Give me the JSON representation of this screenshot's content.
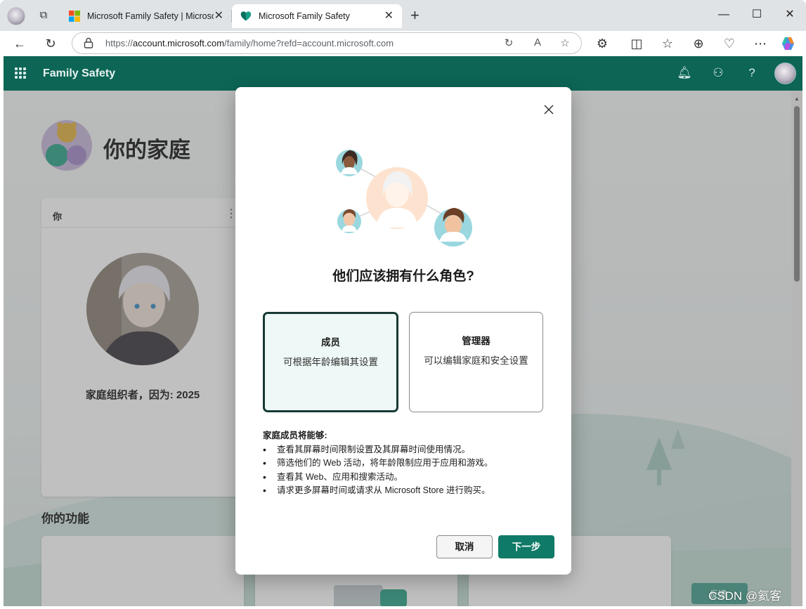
{
  "browser": {
    "tabs": [
      {
        "title": "Microsoft Family Safety | Microsoft",
        "active": false
      },
      {
        "title": "Microsoft Family Safety",
        "active": true
      }
    ],
    "url_prefix": "https://",
    "url_host": "account.microsoft.com",
    "url_path": "/family/home?refd=account.microsoft.com"
  },
  "app": {
    "title": "Family Safety"
  },
  "background": {
    "family_title": "你的家庭",
    "card_title": "你",
    "organizer_text": "家庭组织者，因为: 2025",
    "features_title": "你的功能",
    "feedback_label": "反馈"
  },
  "dialog": {
    "question": "他们应该拥有什么角色?",
    "roles": [
      {
        "name": "成员",
        "description": "可根据年龄编辑其设置",
        "selected": true
      },
      {
        "name": "管理器",
        "description": "可以编辑家庭和安全设置",
        "selected": false
      }
    ],
    "abilities_title": "家庭成员将能够:",
    "abilities": [
      "查看其屏幕时间限制设置及其屏幕时间使用情况。",
      "筛选他们的 Web 活动，将年龄限制应用于应用和游戏。",
      "查看其 Web、应用和搜索活动。",
      "请求更多屏幕时间或请求从 Microsoft Store 进行购买。"
    ],
    "cancel_label": "取消",
    "next_label": "下一步"
  },
  "watermark": "CSDN @氦客",
  "colors": {
    "header": "#0d6555",
    "primary_button": "#0f7a67",
    "selected_card_bg": "#eef8f6",
    "selected_card_border": "#173a35"
  }
}
